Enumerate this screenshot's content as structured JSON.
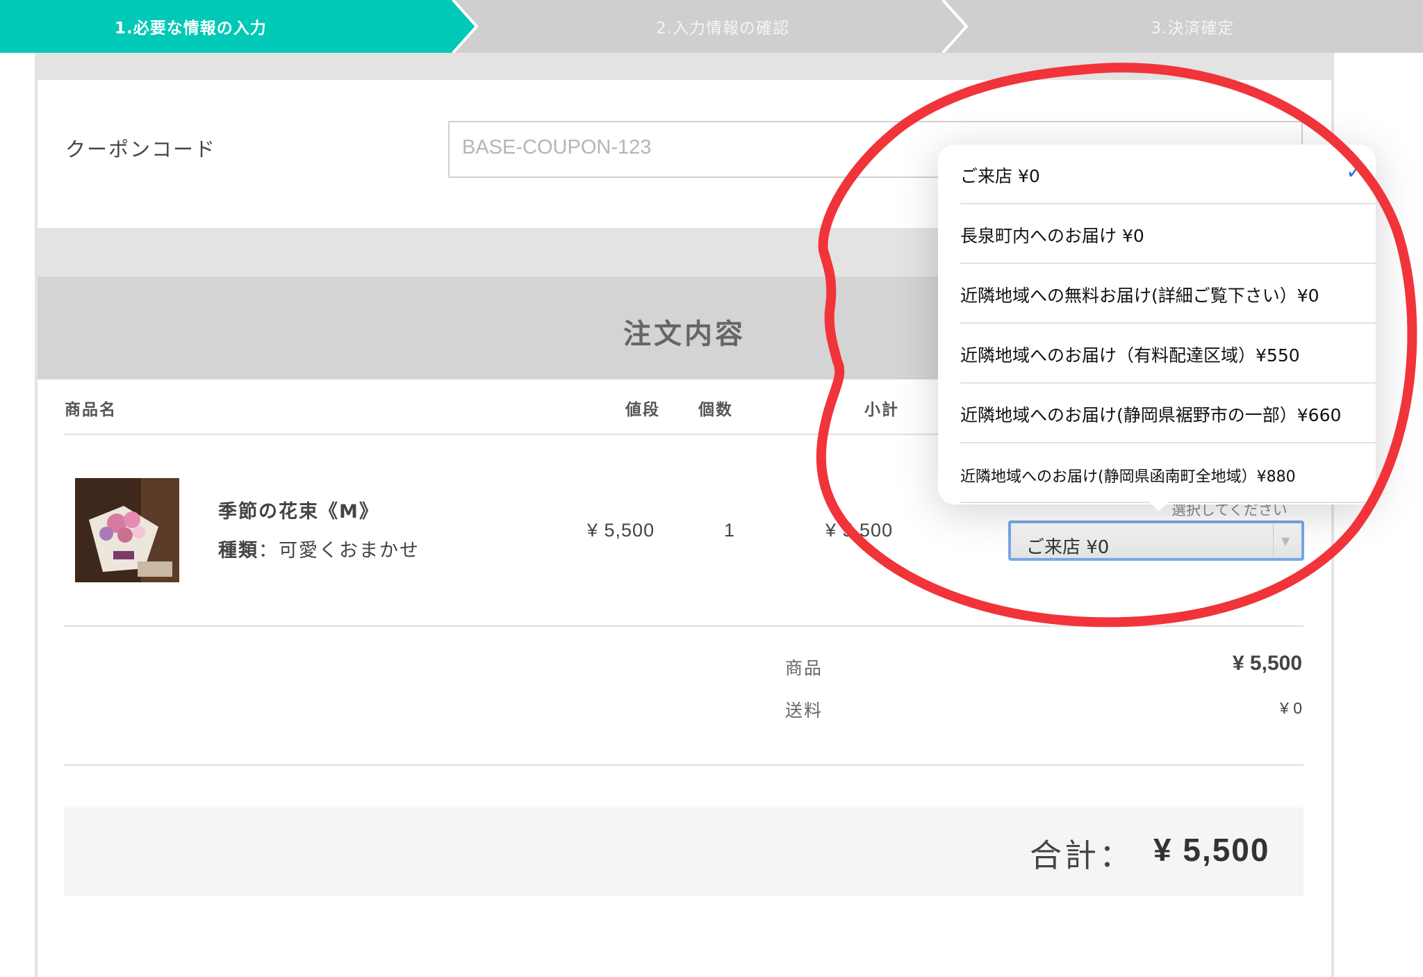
{
  "steps": [
    {
      "label": "1.必要な情報の入力",
      "active": true
    },
    {
      "label": "2.入力情報の確認",
      "active": false
    },
    {
      "label": "3.決済確定",
      "active": false
    }
  ],
  "coupon": {
    "label": "クーポンコード",
    "placeholder": "BASE-COUPON-123"
  },
  "order": {
    "title": "注文内容",
    "columns": {
      "name": "商品名",
      "price": "値段",
      "qty": "個数",
      "subtotal": "小計"
    },
    "item": {
      "name": "季節の花束《M》",
      "variant_label": "種類",
      "variant_sep": "：",
      "variant_value": "可愛くおまかせ",
      "price": "¥ 5,500",
      "qty": "1",
      "subtotal": "¥ 5,500"
    },
    "shipping_select": {
      "hint": "選択してください",
      "selected": "ご来店 ¥0"
    },
    "summary": {
      "product_label": "商品",
      "product_value": "¥ 5,500",
      "shipping_label": "送料",
      "shipping_value": "¥ 0"
    },
    "total": {
      "label": "合計：",
      "value": "¥ 5,500"
    }
  },
  "dropdown": {
    "options": [
      {
        "label": "ご来店 ¥0",
        "selected": true
      },
      {
        "label": "長泉町内へのお届け ¥0",
        "selected": false
      },
      {
        "label": "近隣地域への無料お届け(詳細ご覧下さい）¥0",
        "selected": false
      },
      {
        "label": "近隣地域へのお届け（有料配達区域）¥550",
        "selected": false
      },
      {
        "label": "近隣地域へのお届け(静岡県裾野市の一部）¥660",
        "selected": false
      },
      {
        "label": "近隣地域へのお届け(静岡県函南町全地域）¥880",
        "selected": false
      }
    ]
  },
  "colors": {
    "accent": "#00c9b7",
    "annotation": "#f0343a",
    "check": "#2a74e0"
  }
}
